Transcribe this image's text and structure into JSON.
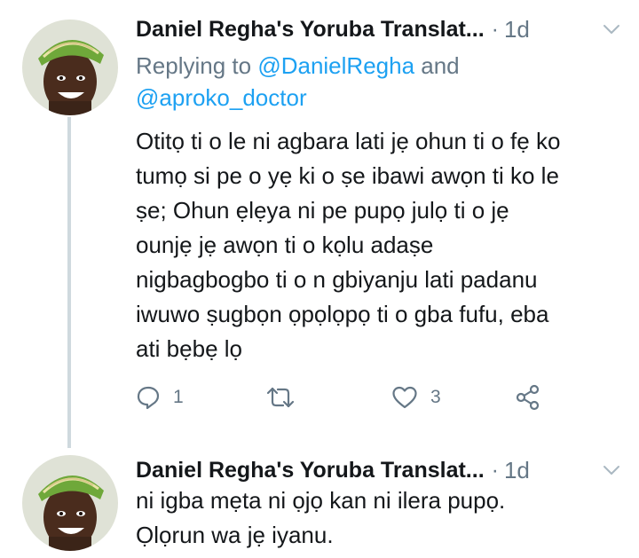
{
  "tweets": [
    {
      "display_name": "Daniel Regha's Yoruba Translat...",
      "separator": "·",
      "time": "1d",
      "reply_prefix": "Replying to ",
      "reply_mention_1": "@DanielRegha",
      "reply_and": " and",
      "reply_mention_2": "@aproko_doctor",
      "text": "Otitọ ti o le ni agbara lati jẹ ohun ti o fẹ ko\ntumọ si pe o yẹ ki o ṣe ibawi awọn ti ko le\nṣe; Ohun ẹlẹya ni pe pupọ julọ ti o jẹ\nounjẹ jẹ awọn ti o kọlu adaṣe\nnigbagbogbo ti o n gbiyanju lati padanu\niwuwo ṣugbọn ọpọlọpọ ti o gba fufu, eba\nati bẹbẹ lọ",
      "reply_count": "1",
      "retweet_count": "",
      "like_count": "3"
    },
    {
      "display_name": "Daniel Regha's Yoruba Translat...",
      "separator": "·",
      "time": "1d",
      "text": "ni igba mẹta ni ọjọ kan ni ilera pupọ.\nỌlọrun wa jẹ iyanu."
    }
  ],
  "colors": {
    "text": "#14171a",
    "muted": "#657786",
    "link": "#1da1f2",
    "thread_line": "#cfd9de"
  },
  "icons": {
    "reply": "reply-icon",
    "retweet": "retweet-icon",
    "like": "heart-icon",
    "share": "share-icon",
    "caret": "chevron-down-icon"
  }
}
